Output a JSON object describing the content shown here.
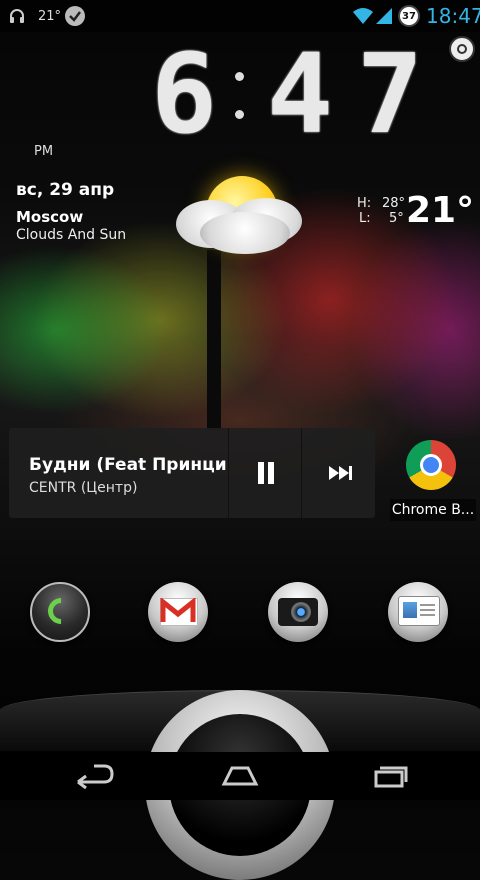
{
  "status_bar": {
    "temperature": "21°",
    "battery_level": "37",
    "time": "18:47",
    "icons": [
      "headphones-icon",
      "check-circle-icon",
      "wifi-icon",
      "signal-icon",
      "battery-icon"
    ]
  },
  "clock_widget": {
    "digits": [
      "6",
      "4",
      "7"
    ],
    "meridiem": "PM",
    "settings_icon": "settings-knob-icon"
  },
  "weather": {
    "date": "вс, 29 апр",
    "city": "Moscow",
    "condition": "Clouds And Sun",
    "high_label": "H:",
    "high_value": "28°",
    "low_label": "L:",
    "low_value": "5°",
    "current_temp": "21°",
    "icon": "cloud-sun-icon"
  },
  "music_widget": {
    "title": "Будни (Feat Принципиальный)",
    "artist": "CENTR (Центр)",
    "controls": [
      "pause-icon",
      "next-track-icon"
    ]
  },
  "shortcut": {
    "label": "Chrome B...",
    "icon": "chrome-icon"
  },
  "dock": {
    "apps": [
      "phone-icon",
      "gmail-icon",
      "camera-icon",
      "messaging-icon"
    ]
  },
  "nav_bar": {
    "buttons": [
      "back-icon",
      "home-icon",
      "recent-apps-icon"
    ]
  },
  "colors": {
    "accent": "#33b5e5",
    "music_bg": "#1e1e1e"
  }
}
